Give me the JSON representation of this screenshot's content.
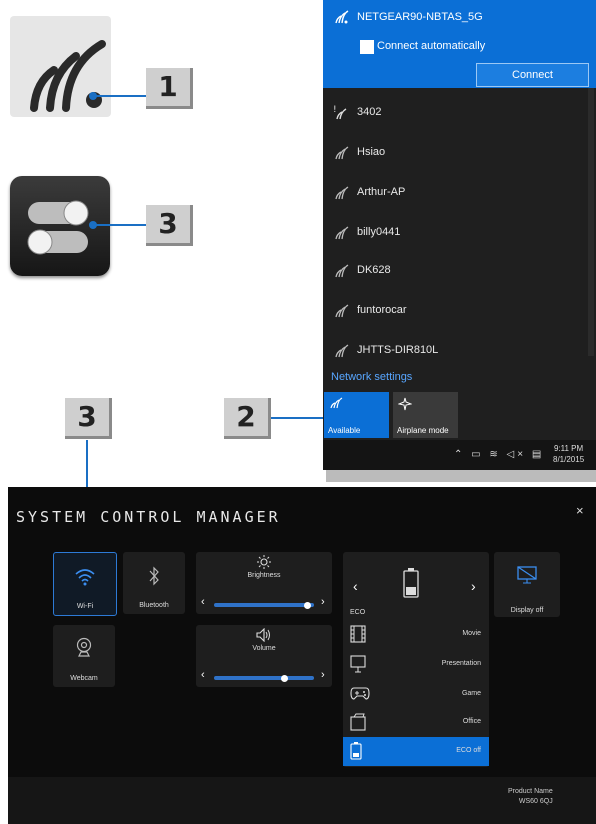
{
  "callouts": {
    "one": "1",
    "three_top": "3",
    "three_bottom": "3",
    "two": "2"
  },
  "flyout": {
    "selected_network": {
      "ssid": "NETGEAR90-NBTAS_5G",
      "auto_connect_label": "Connect automatically",
      "connect_label": "Connect"
    },
    "networks": [
      {
        "ssid": "3402",
        "secured": false
      },
      {
        "ssid": "Hsiao",
        "secured": true
      },
      {
        "ssid": "Arthur-AP",
        "secured": true
      },
      {
        "ssid": "billy0441",
        "secured": true
      },
      {
        "ssid": "DK628",
        "secured": true
      },
      {
        "ssid": "funtorocar",
        "secured": true
      },
      {
        "ssid": "JHTTS-DIR810L",
        "secured": true
      }
    ],
    "network_settings": "Network settings",
    "quick_actions": [
      {
        "label": "Available",
        "icon": "wifi-icon",
        "active": true
      },
      {
        "label": "Airplane mode",
        "icon": "airplane-icon",
        "active": false
      }
    ],
    "taskbar": {
      "time": "9:11 PM",
      "date": "8/1/2015"
    }
  },
  "scm": {
    "title": "SYSTEM CONTROL MANAGER",
    "close": "×",
    "wifi_label": "Wi-Fi",
    "bluetooth_label": "Bluetooth",
    "webcam_label": "Webcam",
    "brightness_label": "Brightness",
    "brightness_level": 0.93,
    "volume_label": "Volume",
    "volume_level": 0.7,
    "power_mode_label": "ECO",
    "display_off_label": "Display off",
    "modes": [
      {
        "name": "Movie",
        "icon": "film-icon",
        "active": false
      },
      {
        "name": "Presentation",
        "icon": "presentation-icon",
        "active": false
      },
      {
        "name": "Game",
        "icon": "gamepad-icon",
        "active": false
      },
      {
        "name": "Office",
        "icon": "office-icon",
        "active": false
      },
      {
        "name": "ECO off",
        "icon": "battery-icon",
        "active": true
      }
    ],
    "product_name_label": "Product Name",
    "product_name_value": "WS60 6QJ"
  },
  "colors": {
    "accent_blue": "#0b6fd6",
    "callout_line": "#1a6fc4",
    "scm_bg": "#0c0c0c"
  }
}
